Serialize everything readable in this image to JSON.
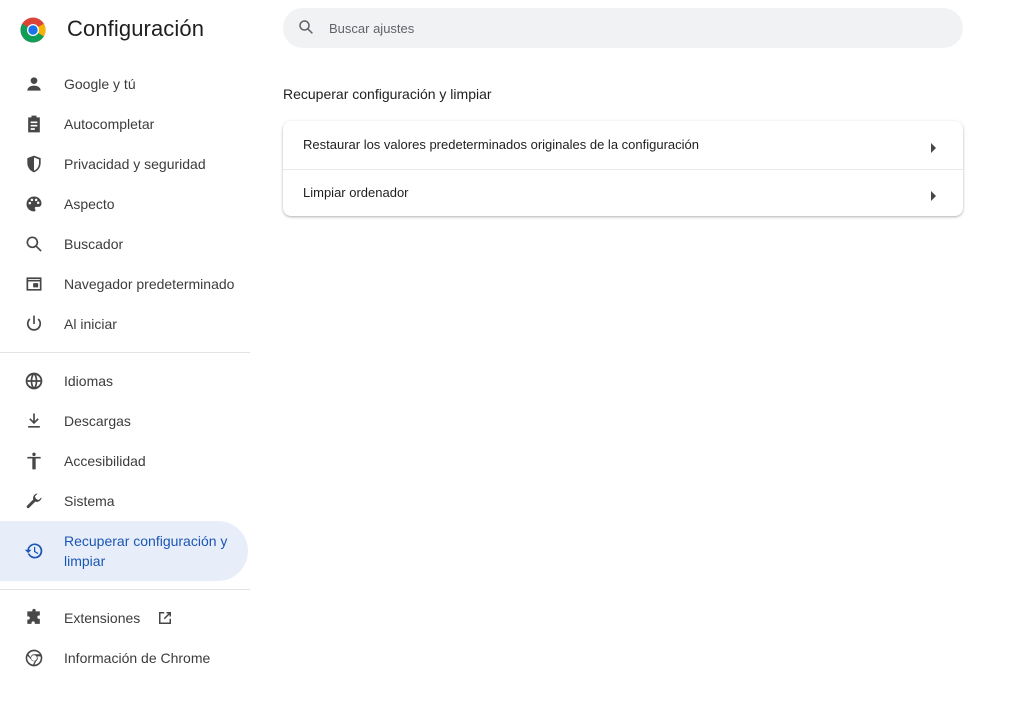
{
  "app": {
    "title": "Configuración"
  },
  "search": {
    "placeholder": "Buscar ajustes",
    "value": ""
  },
  "sidebar": {
    "items": [
      {
        "label": "Google y tú",
        "icon": "person-icon"
      },
      {
        "label": "Autocompletar",
        "icon": "clipboard-icon"
      },
      {
        "label": "Privacidad y seguridad",
        "icon": "shield-icon"
      },
      {
        "label": "Aspecto",
        "icon": "palette-icon"
      },
      {
        "label": "Buscador",
        "icon": "search-icon"
      },
      {
        "label": "Navegador predeterminado",
        "icon": "browser-window-icon"
      },
      {
        "label": "Al iniciar",
        "icon": "power-icon"
      },
      {
        "label": "Idiomas",
        "icon": "globe-icon"
      },
      {
        "label": "Descargas",
        "icon": "download-icon"
      },
      {
        "label": "Accesibilidad",
        "icon": "accessibility-icon"
      },
      {
        "label": "Sistema",
        "icon": "wrench-icon"
      },
      {
        "label": "Recuperar configuración y limpiar",
        "icon": "restore-icon",
        "active": true
      },
      {
        "label": "Extensiones",
        "icon": "puzzle-icon"
      },
      {
        "label": "Información de Chrome",
        "icon": "chrome-icon"
      }
    ]
  },
  "main": {
    "section_title": "Recuperar configuración y limpiar",
    "rows": [
      {
        "label": "Restaurar los valores predeterminados originales de la configuración"
      },
      {
        "label": "Limpiar ordenador"
      }
    ]
  },
  "colors": {
    "accent": "#1a56b5",
    "active_bg": "#e8eef9",
    "search_bg": "#f1f2f4"
  }
}
